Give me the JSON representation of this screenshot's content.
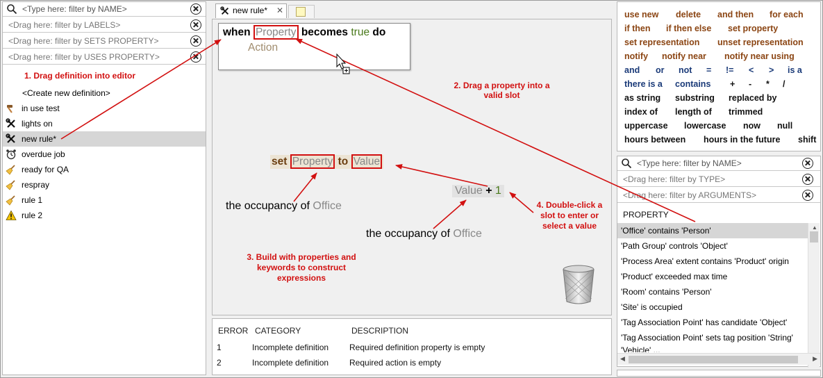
{
  "left_panel": {
    "filter_name_placeholder": "<Type here: filter by NAME>",
    "filter_labels_placeholder": "<Drag here: filter by LABELS>",
    "filter_sets_property_placeholder": "<Drag here: filter by SETS PROPERTY>",
    "filter_uses_property_placeholder": "<Drag here: filter by USES PROPERTY>",
    "create_new": "<Create new definition>",
    "definitions": [
      {
        "label": "in use test",
        "icon": "hammer-icon"
      },
      {
        "label": "lights on",
        "icon": "tools-icon"
      },
      {
        "label": "new rule*",
        "icon": "tools-icon",
        "selected": true
      },
      {
        "label": "overdue job",
        "icon": "alarm-clock-icon"
      },
      {
        "label": "ready for QA",
        "icon": "broom-icon"
      },
      {
        "label": "respray",
        "icon": "broom-icon"
      },
      {
        "label": "rule 1",
        "icon": "broom-icon"
      },
      {
        "label": "rule 2",
        "icon": "warning-icon"
      }
    ]
  },
  "editor": {
    "tab_label": "new rule*",
    "tab_close": "✕",
    "rule": {
      "when": "when",
      "property_slot": "Property",
      "becomes": "becomes",
      "true_kw": "true",
      "do_kw": "do",
      "action_slot": "Action"
    },
    "set_expr": {
      "set": "set",
      "property_slot": "Property",
      "to": "to",
      "value_slot": "Value"
    },
    "occupancy_frag_1": {
      "the_occupancy_of": "the occupancy of",
      "office": "Office"
    },
    "value_plus": {
      "value": "Value",
      "plus": "+",
      "one": "1"
    },
    "occupancy_frag_2": {
      "the_occupancy_of": "the occupancy of",
      "office": "Office"
    }
  },
  "annotations": {
    "step1": "1. Drag definition into editor",
    "step2_line1": "2. Drag a property into a",
    "step2_line2": "valid slot",
    "step3_line1": "3. Build with properties and",
    "step3_line2": "keywords to construct",
    "step3_line3": "expressions",
    "step4_line1": "4. Double-click a",
    "step4_line2": "slot to enter or",
    "step4_line3": "select a value"
  },
  "error_table": {
    "headers": {
      "error": "ERROR",
      "category": "CATEGORY",
      "description": "DESCRIPTION"
    },
    "rows": [
      {
        "error": "1",
        "category": "Incomplete definition",
        "description": "Required definition property is empty"
      },
      {
        "error": "2",
        "category": "Incomplete definition",
        "description": "Required action is empty"
      }
    ]
  },
  "keywords": {
    "row1": [
      "use new",
      "delete",
      "and then",
      "for each"
    ],
    "row2": [
      "if then",
      "if then else",
      "set property"
    ],
    "row3": [
      "set representation",
      "unset representation"
    ],
    "row4": [
      "notify",
      "notify near",
      "notify near using"
    ],
    "row5": [
      "and",
      "or",
      "not",
      "=",
      "!=",
      "<",
      ">",
      "is a"
    ],
    "row6": [
      "there is a",
      "contains",
      "+",
      "-",
      "*",
      "/"
    ],
    "row7": [
      "as string",
      "substring",
      "replaced by"
    ],
    "row8": [
      "index of",
      "length of",
      "trimmed"
    ],
    "row9": [
      "uppercase",
      "lowercase",
      "now",
      "null"
    ],
    "row10": [
      "hours between",
      "hours in the future",
      "shift"
    ]
  },
  "property_panel": {
    "filter_name_placeholder": "<Type here: filter by NAME>",
    "filter_type_placeholder": "<Drag here: filter by TYPE>",
    "filter_arguments_placeholder": "<Drag here: filter by ARGUMENTS>",
    "header": "PROPERTY",
    "items": [
      "'Office' contains 'Person'",
      "'Path Group' controls 'Object'",
      "'Process Area' extent contains 'Product' origin",
      "'Product' exceeded max time",
      "'Room' contains 'Person'",
      "'Site' is occupied",
      "'Tag Association Point' has candidate 'Object'",
      "'Tag Association Point' sets tag position 'String'",
      "'Vehicle' ..."
    ],
    "selected_index": 0
  },
  "colors": {
    "annotation_red": "#d21010",
    "keyword_brown": "#8b4513",
    "keyword_blue": "#1a3a78",
    "true_green": "#4a7a1c",
    "selection_gray": "#d6d6d6"
  }
}
